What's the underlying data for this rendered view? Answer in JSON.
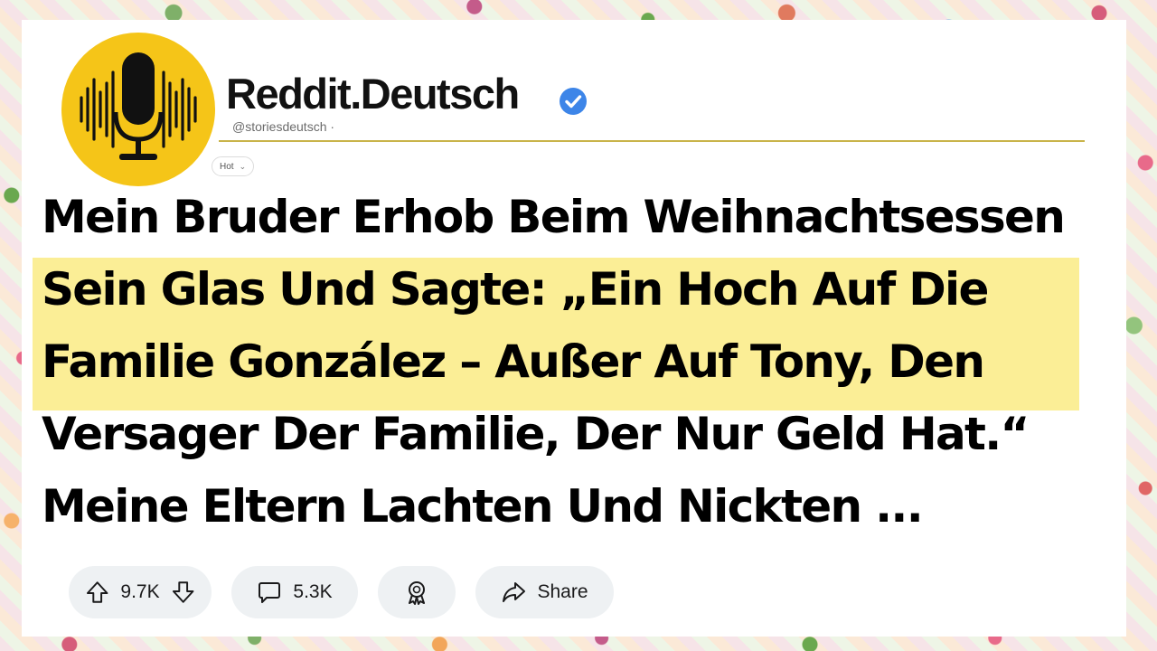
{
  "channel": {
    "name": "Reddit.Deutsch",
    "handle": "@storiesdeutsch ·",
    "verified_icon": "verified-check-icon",
    "avatar_icon": "microphone-soundwave-icon"
  },
  "sort": {
    "label": "Hot",
    "icon": "chevron-down-icon"
  },
  "post": {
    "title_lines": [
      "Mein Bruder Erhob Beim Weihnachtsessen",
      "Sein Glas Und Sagte: „Ein Hoch Auf Die",
      "Familie González – Außer Auf Tony, Den",
      "Versager Der Familie, Der Nur Geld Hat.“",
      "Meine Eltern Lachten Und Nickten ..."
    ]
  },
  "actions": {
    "upvotes": "9.7K",
    "comments": "5.3K",
    "share_label": "Share"
  },
  "colors": {
    "highlight": "#fbee96",
    "avatar_bg": "#f5c518",
    "verified": "#3d85e8",
    "divider": "#c9b44a",
    "pill_bg": "#eef1f3"
  }
}
